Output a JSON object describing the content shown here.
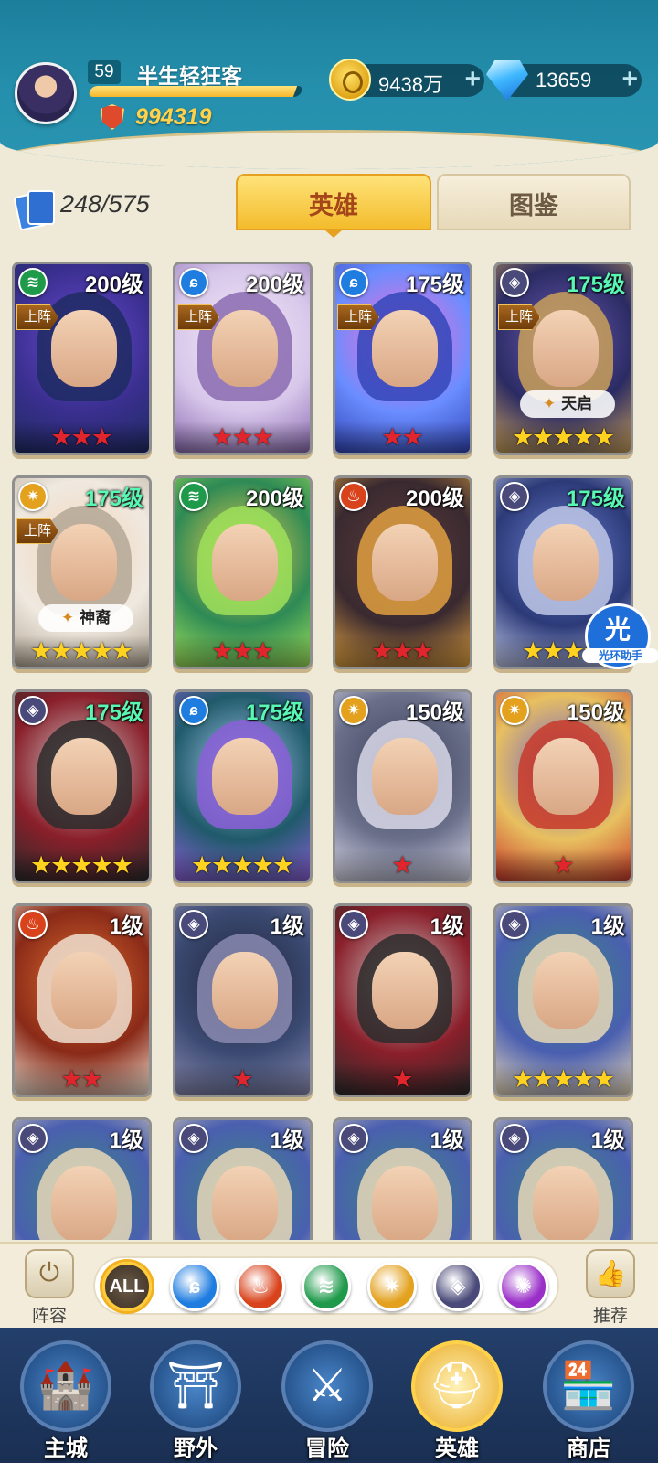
{
  "player": {
    "level": "59",
    "name": "半生轻狂客",
    "exp_fraction": 0.97,
    "power": "994319"
  },
  "resources": {
    "gold": "9438万",
    "gems": "13659",
    "plus_symbol": "+"
  },
  "collection": {
    "count": "248/575"
  },
  "tabs": [
    {
      "label": "英雄",
      "active": true
    },
    {
      "label": "图鉴",
      "active": false
    }
  ],
  "heroes": [
    {
      "level": "200级",
      "element": "wind",
      "deployed": true,
      "badge": "",
      "stars": 3,
      "star_color": "red",
      "palette": [
        "#3a2f8f",
        "#1f2b63",
        "#6a4ad3"
      ]
    },
    {
      "level": "200级",
      "element": "water",
      "deployed": true,
      "badge": "",
      "stars": 3,
      "star_color": "red",
      "palette": [
        "#d7c6ea",
        "#8a6bb0",
        "#f4e9f6"
      ]
    },
    {
      "level": "175级",
      "element": "water",
      "deployed": true,
      "badge": "",
      "stars": 2,
      "star_color": "red",
      "palette": [
        "#6a8dff",
        "#3346b8",
        "#ff6ad2"
      ]
    },
    {
      "level": "175级",
      "element": "dark",
      "deployed": true,
      "badge": "天启",
      "stars": 5,
      "star_color": "gold",
      "palette": [
        "#2b2b63",
        "#c9a05a",
        "#6d5bb5"
      ]
    },
    {
      "level": "175级",
      "element": "light",
      "deployed": true,
      "badge": "神裔",
      "stars": 5,
      "star_color": "gold",
      "palette": [
        "#efe9e0",
        "#b4a795",
        "#f5d4b8"
      ]
    },
    {
      "level": "200级",
      "element": "wind",
      "deployed": false,
      "badge": "",
      "stars": 3,
      "star_color": "red",
      "palette": [
        "#2e8a55",
        "#9ee05a",
        "#f0d050"
      ]
    },
    {
      "level": "200级",
      "element": "fire",
      "deployed": false,
      "badge": "",
      "stars": 3,
      "star_color": "red",
      "palette": [
        "#3a2a30",
        "#e0a040",
        "#5a3b3b"
      ]
    },
    {
      "level": "175级",
      "element": "dark",
      "deployed": false,
      "badge": "",
      "stars": 4,
      "star_color": "gold",
      "palette": [
        "#2c3a78",
        "#c0c8e8",
        "#6b7fd0"
      ]
    },
    {
      "level": "175级",
      "element": "dark",
      "deployed": false,
      "badge": "",
      "stars": 5,
      "star_color": "gold",
      "palette": [
        "#8a1f2a",
        "#2b2b2b",
        "#d0d0d0"
      ]
    },
    {
      "level": "175级",
      "element": "water",
      "deployed": false,
      "badge": "",
      "stars": 5,
      "star_color": "gold",
      "palette": [
        "#1f5a6a",
        "#8b5fd8",
        "#a9c9f0"
      ]
    },
    {
      "level": "150级",
      "element": "light",
      "deployed": false,
      "badge": "",
      "stars": 1,
      "star_color": "red",
      "palette": [
        "#6a6f8a",
        "#d8d8e8",
        "#3b3f5a"
      ]
    },
    {
      "level": "150级",
      "element": "light",
      "deployed": false,
      "badge": "",
      "stars": 1,
      "star_color": "red",
      "palette": [
        "#e8c060",
        "#c83a2a",
        "#6a5ad0"
      ]
    },
    {
      "level": "1级",
      "element": "fire",
      "deployed": false,
      "badge": "",
      "stars": 2,
      "star_color": "red",
      "palette": [
        "#8a2a18",
        "#f0e0d0",
        "#e07030"
      ]
    },
    {
      "level": "1级",
      "element": "dark",
      "deployed": false,
      "badge": "",
      "stars": 1,
      "star_color": "red",
      "palette": [
        "#3b4a72",
        "#8a8ab0",
        "#1f2238"
      ]
    },
    {
      "level": "1级",
      "element": "dark",
      "deployed": false,
      "badge": "",
      "stars": 1,
      "star_color": "red",
      "palette": [
        "#8a1f2a",
        "#2b2b2b",
        "#d0d0d0"
      ]
    },
    {
      "level": "1级",
      "element": "dark",
      "deployed": false,
      "badge": "",
      "stars": 5,
      "star_color": "gold",
      "palette": [
        "#4a5fb0",
        "#e8d8b8",
        "#3a8a7a"
      ]
    },
    {
      "level": "1级",
      "element": "dark",
      "deployed": false,
      "badge": "",
      "stars": 0,
      "star_color": "gold",
      "palette": [
        "#4a5fb0",
        "#e8d8b8",
        "#3a8a7a"
      ]
    },
    {
      "level": "1级",
      "element": "dark",
      "deployed": false,
      "badge": "",
      "stars": 0,
      "star_color": "gold",
      "palette": [
        "#4a5fb0",
        "#e8d8b8",
        "#3a8a7a"
      ]
    },
    {
      "level": "1级",
      "element": "dark",
      "deployed": false,
      "badge": "",
      "stars": 0,
      "star_color": "gold",
      "palette": [
        "#4a5fb0",
        "#e8d8b8",
        "#3a8a7a"
      ]
    },
    {
      "level": "1级",
      "element": "dark",
      "deployed": false,
      "badge": "",
      "stars": 0,
      "star_color": "gold",
      "palette": [
        "#4a5fb0",
        "#e8d8b8",
        "#3a8a7a"
      ]
    }
  ],
  "labels": {
    "deployed": "上阵"
  },
  "watermark": {
    "glyph": "光",
    "text": "光环助手"
  },
  "element_colors": {
    "wind": "#1e9a4a",
    "water": "#1f7de0",
    "dark": "#4a4a7a",
    "light": "#e3a11e",
    "fire": "#d9431c"
  },
  "filters": [
    {
      "name": "all",
      "label": "ALL",
      "color": "#3b2f23"
    },
    {
      "name": "water",
      "label": "",
      "color": "#1f7de0"
    },
    {
      "name": "fire",
      "label": "",
      "color": "#d9431c"
    },
    {
      "name": "wind",
      "label": "",
      "color": "#1e9a4a"
    },
    {
      "name": "light",
      "label": "",
      "color": "#e3a11e"
    },
    {
      "name": "dark",
      "label": "",
      "color": "#4a4a7a"
    },
    {
      "name": "chaos",
      "label": "",
      "color": "#9a2fc8"
    }
  ],
  "side_buttons": {
    "lineup": "阵容",
    "recommend": "推荐"
  },
  "nav": [
    {
      "label": "主城",
      "icon": "castle-icon",
      "active": false
    },
    {
      "label": "野外",
      "icon": "portal-icon",
      "active": false
    },
    {
      "label": "冒险",
      "icon": "sword-icon",
      "active": false
    },
    {
      "label": "英雄",
      "icon": "helmet-icon",
      "active": true
    },
    {
      "label": "商店",
      "icon": "shop-icon",
      "active": false
    }
  ]
}
